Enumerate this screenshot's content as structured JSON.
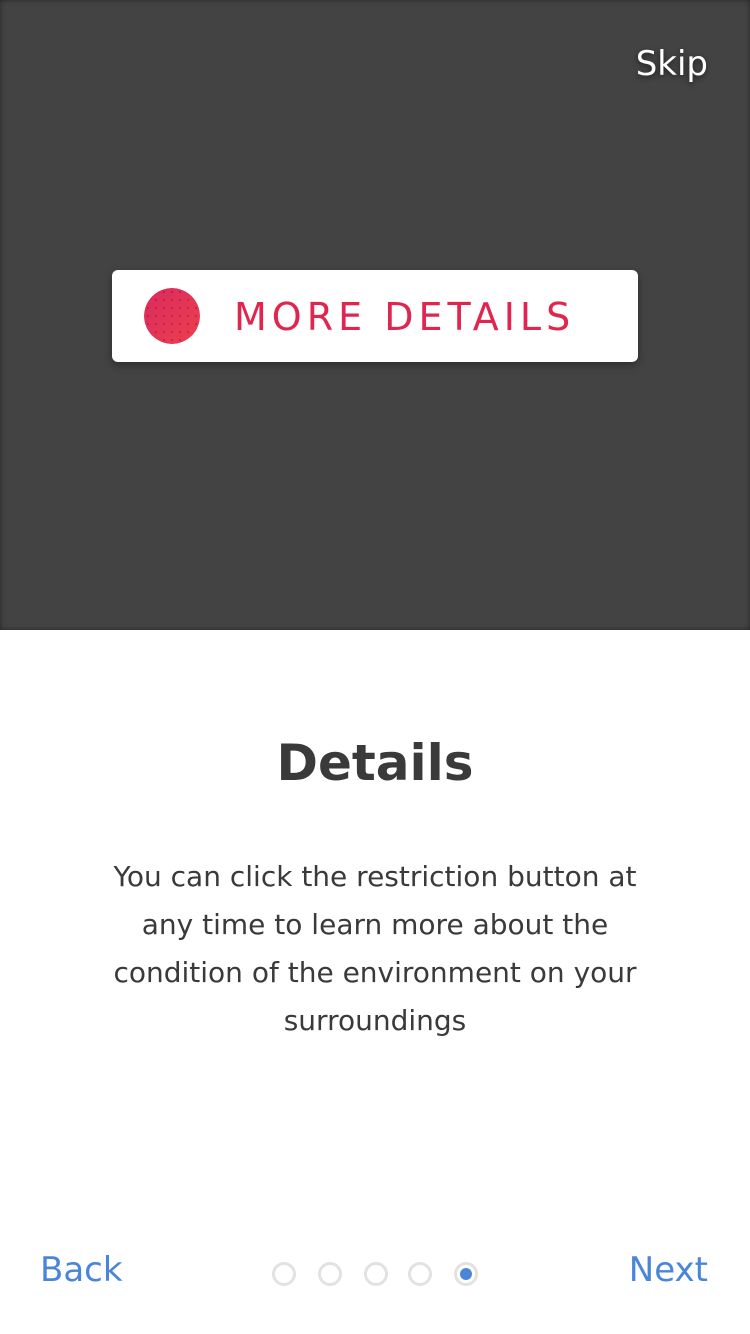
{
  "hero": {
    "skip_label": "Skip",
    "button": {
      "label": "MORE DETAILS",
      "icon": "status-dot-icon",
      "accent_color": "#e0264e"
    },
    "background_color": "#434343"
  },
  "content": {
    "title": "Details",
    "description": "You can click the restriction button at any time to learn more about the condition of the environment on your surroundings"
  },
  "footer": {
    "back_label": "Back",
    "next_label": "Next",
    "pages": {
      "total": 5,
      "current": 5
    },
    "link_color": "#4a86d8"
  }
}
